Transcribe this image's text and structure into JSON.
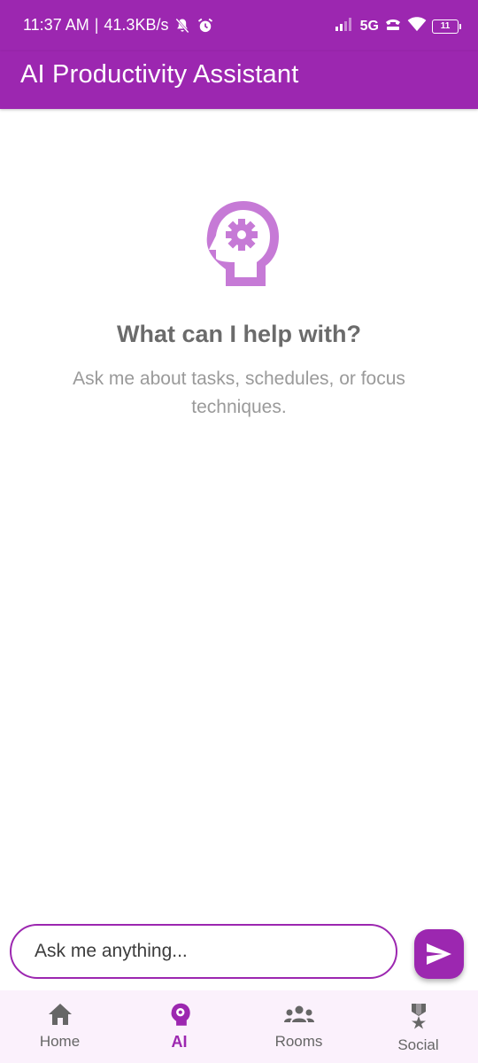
{
  "status_bar": {
    "time": "11:37 AM",
    "separator": "|",
    "speed": "41.3KB/s",
    "network": "5G",
    "battery": "11"
  },
  "app_bar": {
    "title": "AI Productivity Assistant"
  },
  "empty_state": {
    "icon": "psychology-head-gear-icon",
    "title": "What can I help with?",
    "subtitle": "Ask me about tasks, schedules, or focus techniques."
  },
  "composer": {
    "placeholder": "Ask me anything...",
    "send_icon": "send-icon"
  },
  "bottom_nav": {
    "items": [
      {
        "label": "Home",
        "icon": "home-icon",
        "active": false
      },
      {
        "label": "AI",
        "icon": "psychology-icon",
        "active": true
      },
      {
        "label": "Rooms",
        "icon": "groups-icon",
        "active": false
      },
      {
        "label": "Social",
        "icon": "military-medal-icon",
        "active": false
      }
    ]
  },
  "colors": {
    "primary": "#9c27b0",
    "hero_icon": "#c67ad6",
    "title_text": "#6b6b6b",
    "subtitle_text": "#9a9a9a",
    "nav_background": "#fbf1fc",
    "nav_inactive": "#666666"
  }
}
